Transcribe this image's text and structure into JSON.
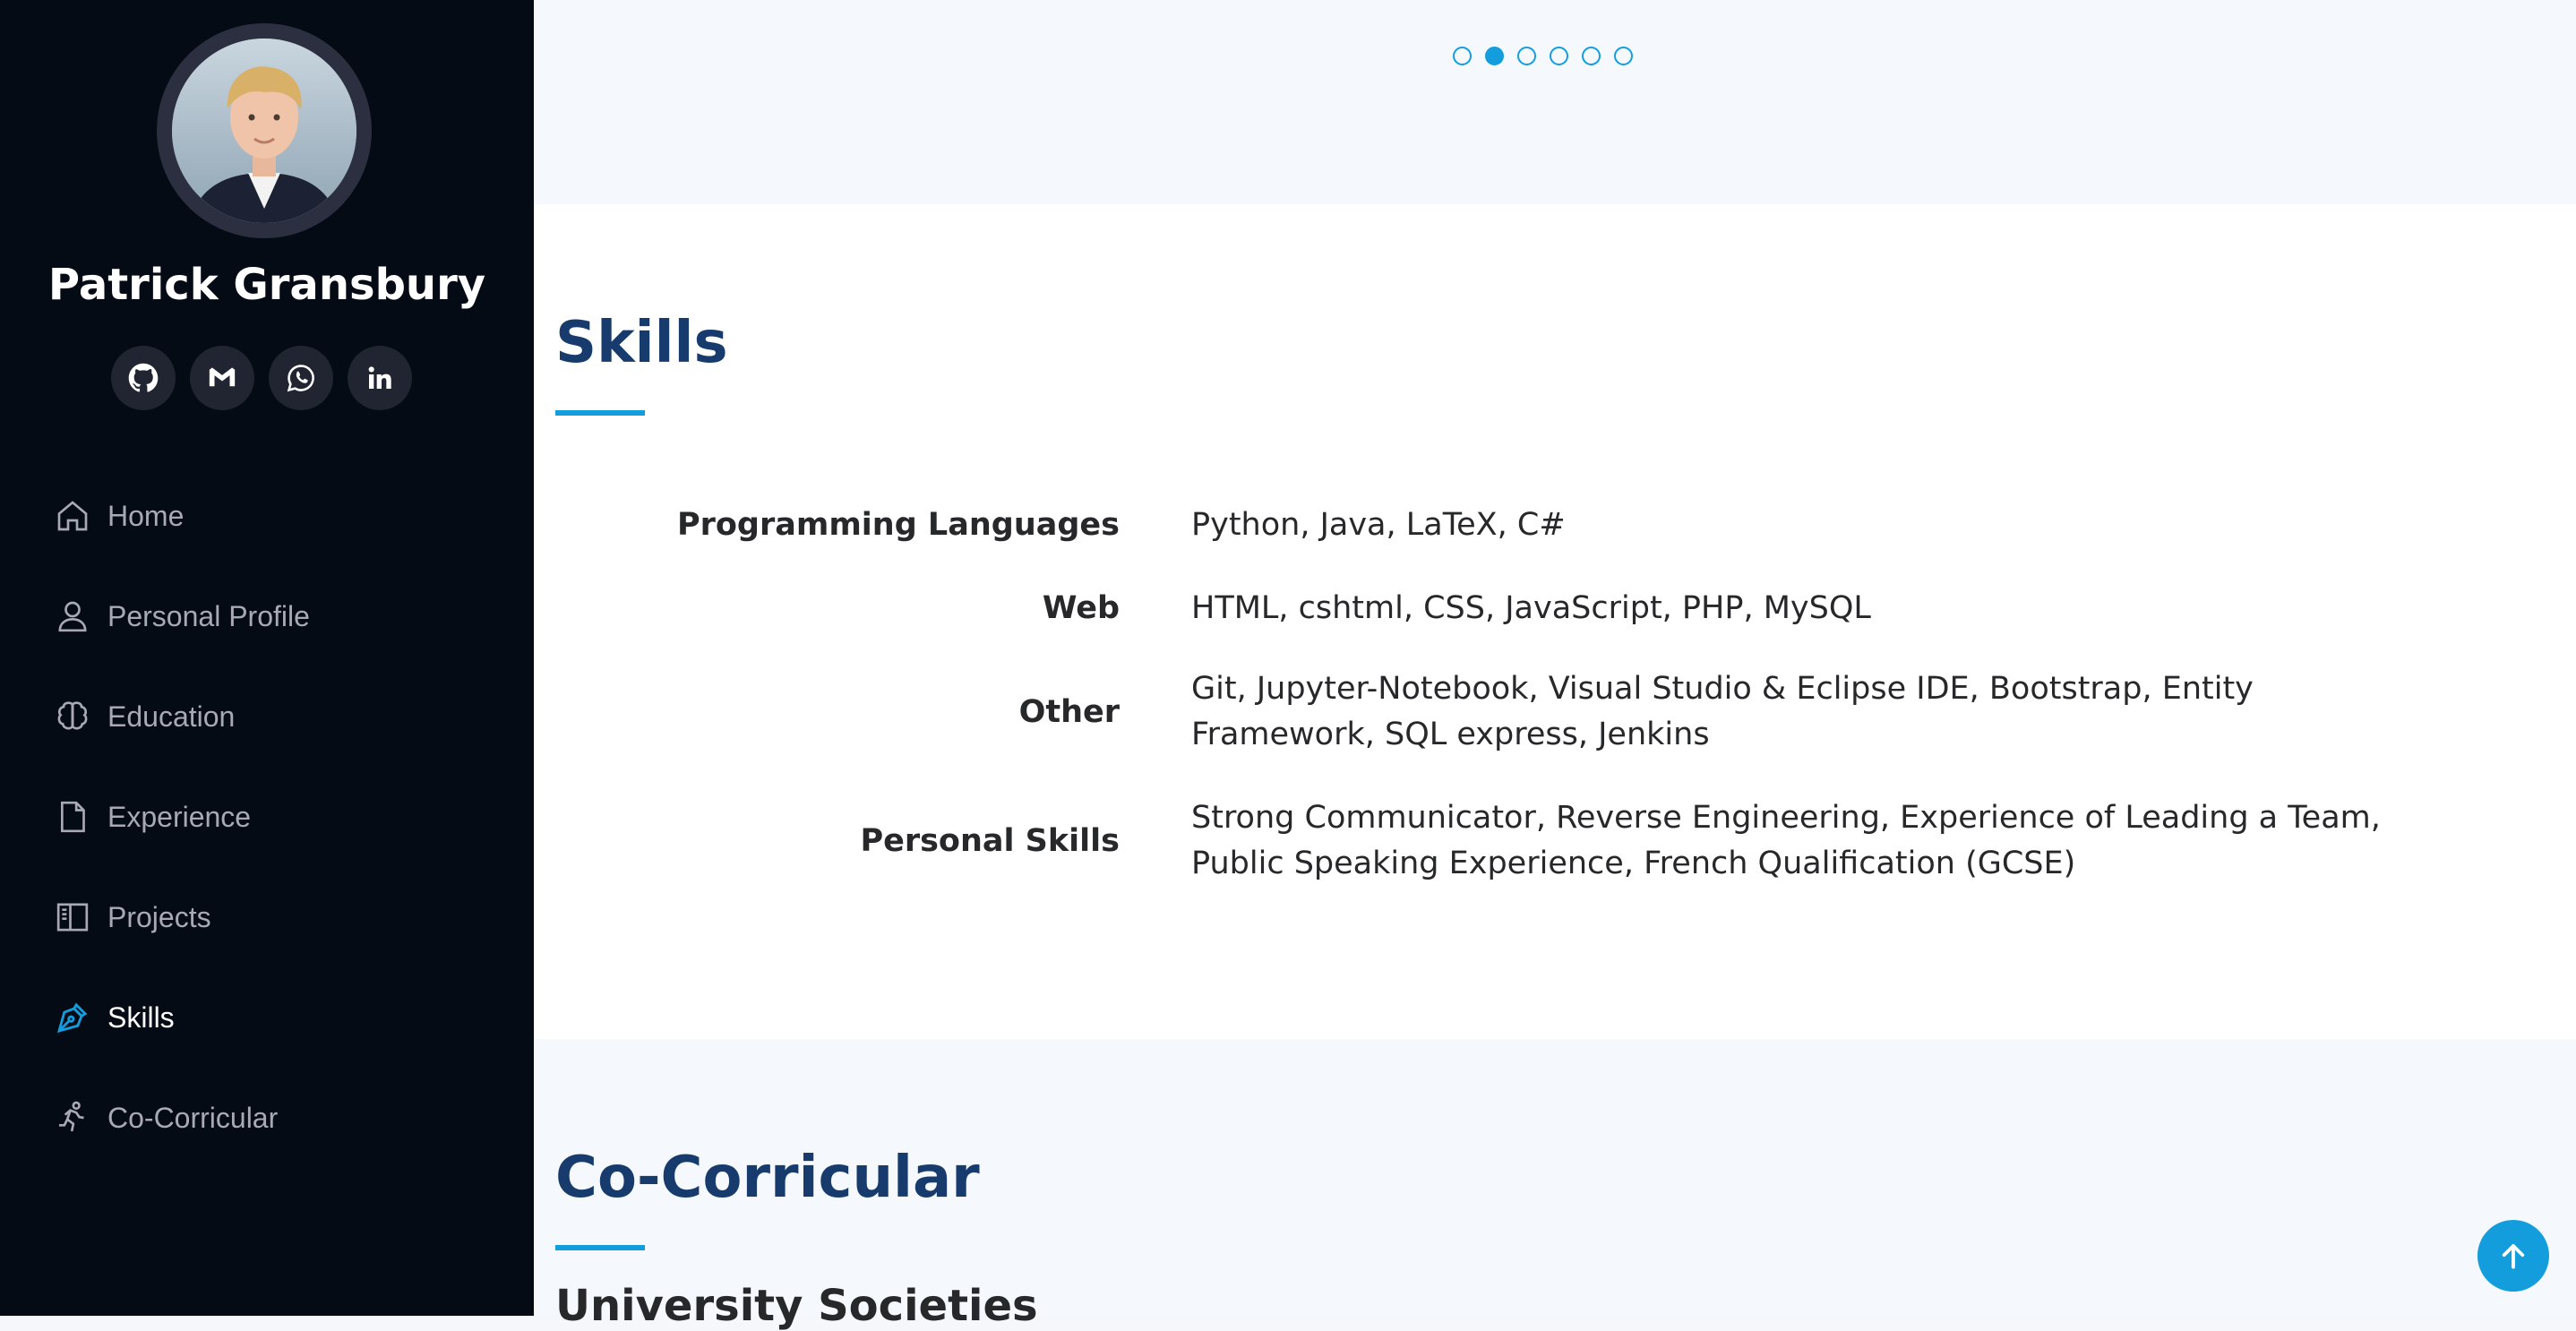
{
  "profile": {
    "name": "Patrick Gransbury"
  },
  "social": [
    {
      "icon": "github-icon"
    },
    {
      "icon": "gmail-icon"
    },
    {
      "icon": "whatsapp-icon"
    },
    {
      "icon": "linkedin-icon"
    }
  ],
  "nav": [
    {
      "label": "Home",
      "icon": "house-icon"
    },
    {
      "label": "Personal Profile",
      "icon": "person-icon"
    },
    {
      "label": "Education",
      "icon": "brain-icon"
    },
    {
      "label": "Experience",
      "icon": "file-icon"
    },
    {
      "label": "Projects",
      "icon": "layout-panel-icon"
    },
    {
      "label": "Skills",
      "icon": "pen-nib-icon",
      "active": true
    },
    {
      "label": "Co-Corricular",
      "icon": "running-person-icon"
    }
  ],
  "carousel": {
    "total": 6,
    "active_index": 1
  },
  "skills": {
    "title": "Skills",
    "rows": [
      {
        "key": "Programming Languages",
        "value": "Python, Java, LaTeX, C#"
      },
      {
        "key": "Web",
        "value": "HTML, cshtml, CSS, JavaScript, PHP, MySQL"
      },
      {
        "key": "Other",
        "value": "Git, Jupyter-Notebook, Visual Studio & Eclipse IDE, Bootstrap, Entity Framework, SQL express, Jenkins"
      },
      {
        "key": "Personal Skills",
        "value": "Strong Communicator, Reverse Engineering, Experience of Leading a Team, Public Speaking Experience, French Qualification (GCSE)"
      }
    ]
  },
  "cocurricular": {
    "title": "Co-Corricular",
    "subtitle": "University Societies"
  },
  "colors": {
    "accent": "#149ddd",
    "heading": "#173b6c",
    "sidebar": "#040b14"
  }
}
